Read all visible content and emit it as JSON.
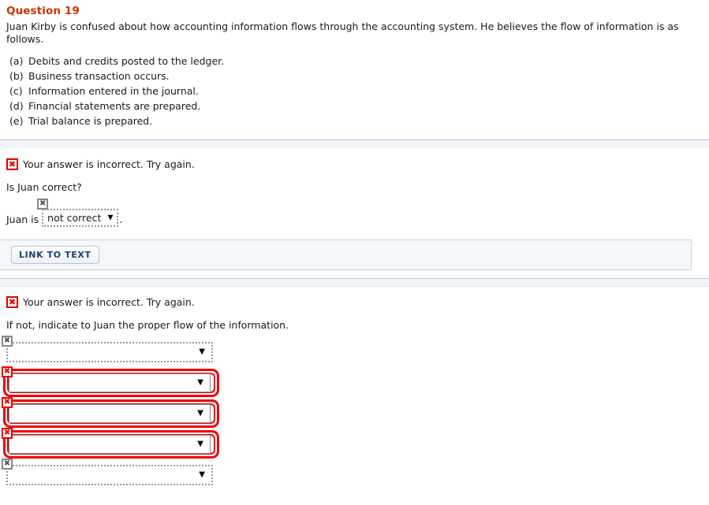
{
  "question": {
    "title": "Question 19",
    "intro": "Juan Kirby is confused about how accounting information flows through the accounting system. He believes the flow of information is as follows.",
    "items": [
      {
        "label": "(a)",
        "text": "Debits and credits posted to the ledger."
      },
      {
        "label": "(b)",
        "text": "Business transaction occurs."
      },
      {
        "label": "(c)",
        "text": "Information entered in the journal."
      },
      {
        "label": "(d)",
        "text": "Financial statements are prepared."
      },
      {
        "label": "(e)",
        "text": "Trial balance is prepared."
      }
    ]
  },
  "part_one": {
    "feedback": "Your answer is incorrect.  Try again.",
    "feedback_icon": "x-mark-icon",
    "prompt": "Is Juan correct?",
    "answer_prefix": "Juan is",
    "answer_value": "not correct",
    "answer_caret": "▼",
    "answer_suffix": ".",
    "marker_icon": "x-mark-icon",
    "marker_state": "gray"
  },
  "link_to_text": {
    "label": "LINK TO TEXT"
  },
  "part_two": {
    "feedback": "Your answer is incorrect.  Try again.",
    "feedback_icon": "x-mark-icon",
    "prompt": "If not, indicate to Juan the proper flow of the information.",
    "caret": "▼",
    "marker_icon": "x-mark-icon",
    "selects": [
      {
        "value": "",
        "state": "dotted",
        "marker_state": "gray"
      },
      {
        "value": "",
        "state": "error",
        "marker_state": "red"
      },
      {
        "value": "",
        "state": "error",
        "marker_state": "red"
      },
      {
        "value": "",
        "state": "error",
        "marker_state": "red"
      },
      {
        "value": "",
        "state": "dotted",
        "marker_state": "gray"
      }
    ]
  },
  "icons": {
    "x_glyph": "✖"
  },
  "colors": {
    "title": "#cc3300",
    "error": "#ee0000",
    "band": "#f2f6fa",
    "rule": "#b9c2cc",
    "button_text": "#1b3f7a"
  }
}
